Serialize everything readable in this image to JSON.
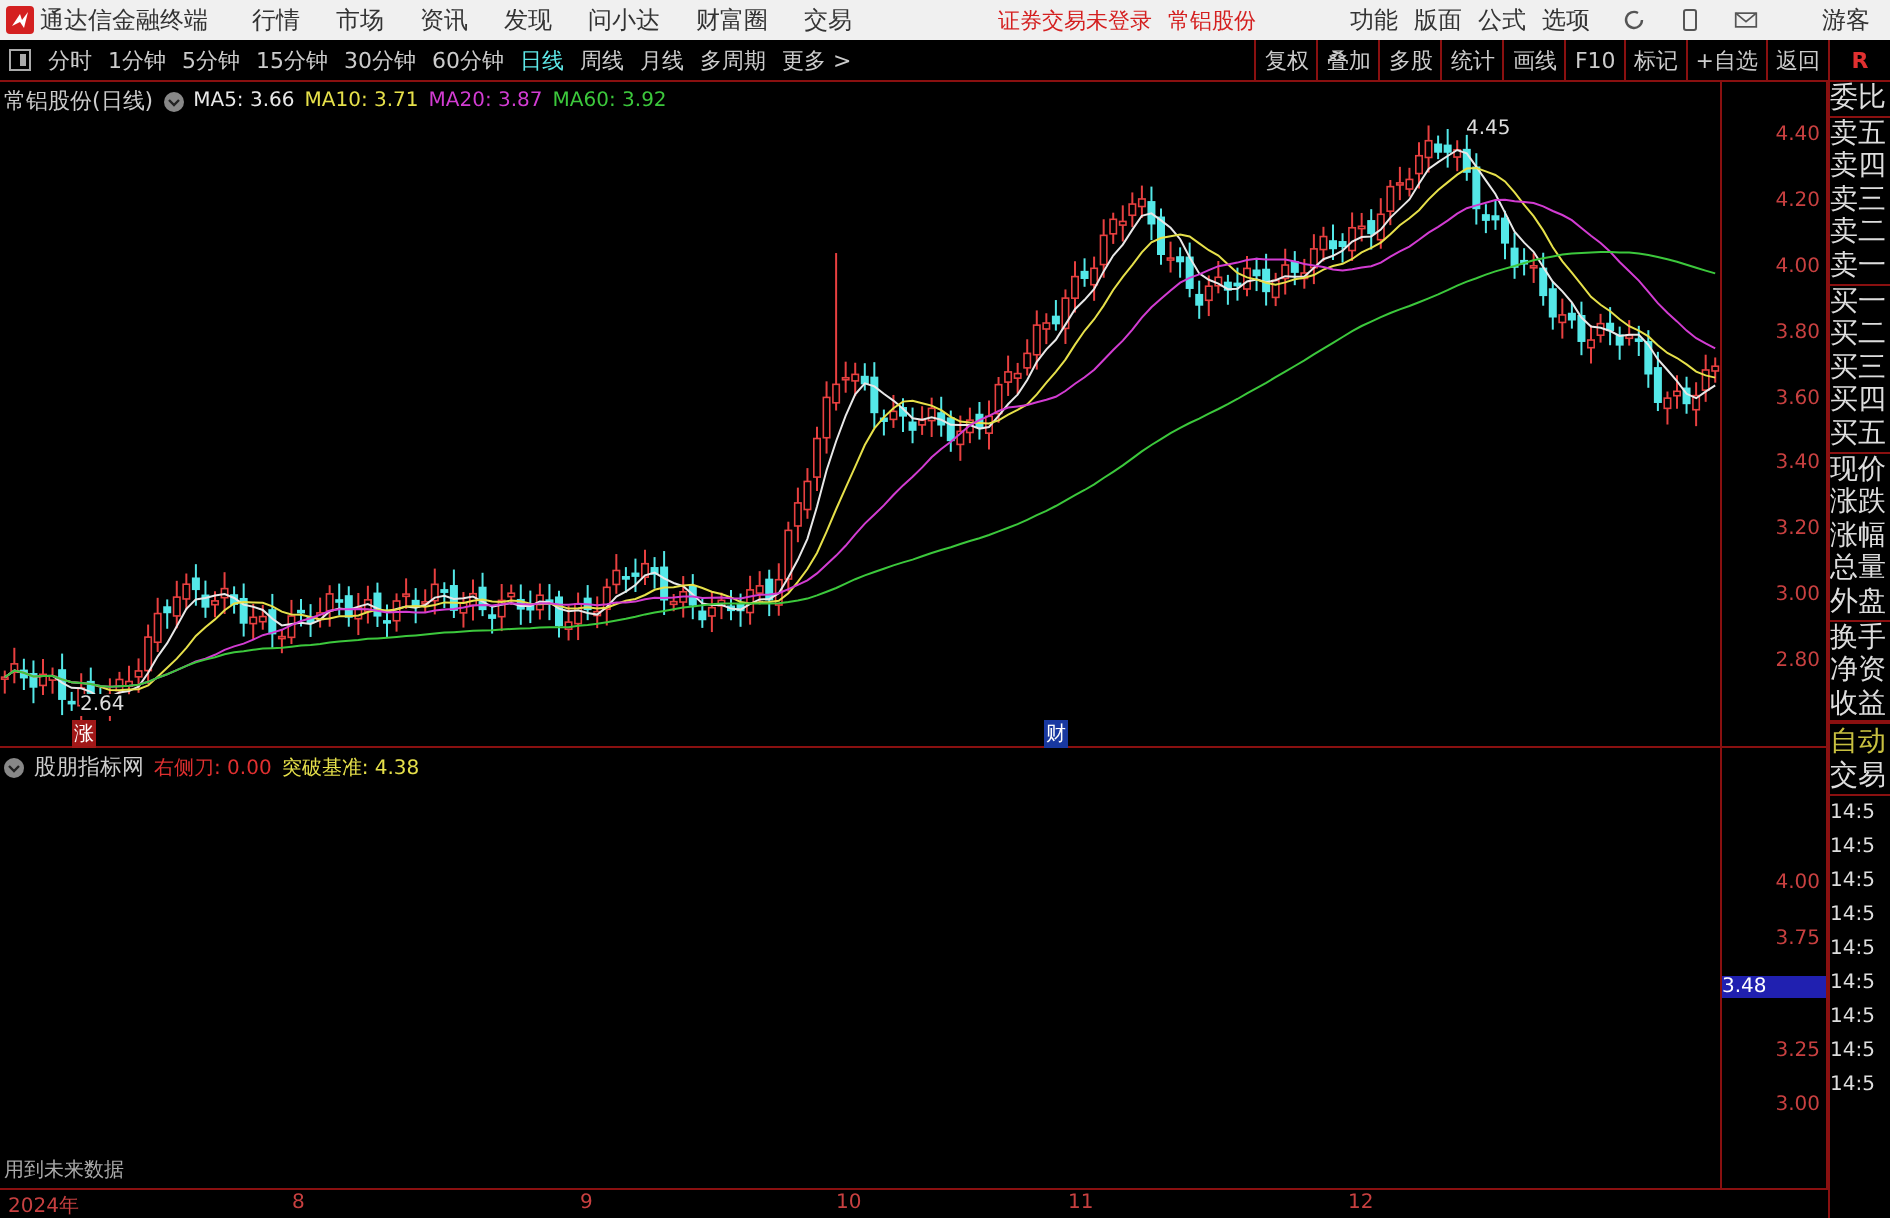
{
  "menu_bar": {
    "app_title": "通达信金融终端",
    "items": [
      "行情",
      "市场",
      "资讯",
      "发现",
      "问小达",
      "财富圈",
      "交易"
    ],
    "notices": [
      "证券交易未登录",
      "常铝股份"
    ],
    "right_items": [
      "功能",
      "版面",
      "公式",
      "选项"
    ],
    "user": "游客"
  },
  "toolbar": {
    "periods": [
      {
        "label": "分时",
        "selected": false
      },
      {
        "label": "1分钟",
        "selected": false
      },
      {
        "label": "5分钟",
        "selected": false
      },
      {
        "label": "15分钟",
        "selected": false
      },
      {
        "label": "30分钟",
        "selected": false
      },
      {
        "label": "60分钟",
        "selected": false
      },
      {
        "label": "日线",
        "selected": true
      },
      {
        "label": "周线",
        "selected": false
      },
      {
        "label": "月线",
        "selected": false
      },
      {
        "label": "多周期",
        "selected": false
      },
      {
        "label": "更多 >",
        "selected": false
      }
    ],
    "buttons": [
      "复权",
      "叠加",
      "多股",
      "统计",
      "画线",
      "F10",
      "标记",
      "+自选",
      "返回"
    ],
    "corner": "R"
  },
  "price_chart": {
    "title": "常铝股份(日线)",
    "legend": [
      {
        "text": "MA5: 3.66",
        "color": "#e8e8e8"
      },
      {
        "text": "MA10: 3.71",
        "color": "#e6e04a"
      },
      {
        "text": "MA20: 3.87",
        "color": "#d23cd2"
      },
      {
        "text": "MA60: 3.92",
        "color": "#3cc83c"
      }
    ],
    "high_label": "4.45",
    "low_label": "2.64",
    "markers": [
      {
        "text": "涨",
        "kind": "rise"
      },
      {
        "text": "财",
        "kind": "finance"
      }
    ],
    "yticks": [
      "4.40",
      "4.20",
      "4.00",
      "3.80",
      "3.60",
      "3.40",
      "3.20",
      "3.00",
      "2.80"
    ]
  },
  "indicator": {
    "title": "股朋指标网",
    "legend": [
      {
        "text": "右侧刀: 0.00",
        "color": "#e03030"
      },
      {
        "text": "突破基准: 4.38",
        "color": "#e6e04a"
      }
    ],
    "yticks": [
      {
        "label": "4.00",
        "kind": "tick"
      },
      {
        "label": "3.75",
        "kind": "tick"
      },
      {
        "label": "3.48",
        "kind": "current"
      },
      {
        "label": "3.25",
        "kind": "tick"
      },
      {
        "label": "3.00",
        "kind": "tick"
      }
    ],
    "note": "用到未来数据"
  },
  "x_axis": [
    "2024年",
    "8",
    "9",
    "10",
    "11",
    "12"
  ],
  "side_panel": {
    "groups": [
      [
        "委比"
      ],
      [
        "卖五",
        "卖四",
        "卖三",
        "卖二",
        "卖一"
      ],
      [
        "买一",
        "买二",
        "买三",
        "买四",
        "买五"
      ],
      [
        "现价",
        "涨跌",
        "涨幅",
        "总量",
        "外盘"
      ],
      [
        "换手",
        "净资",
        "收益"
      ]
    ],
    "mode": "自动",
    "trade": "交易",
    "times": [
      "14:5",
      "14:5",
      "14:5",
      "14:5",
      "14:5",
      "14:5",
      "14:5",
      "14:5",
      "14:5"
    ]
  }
}
